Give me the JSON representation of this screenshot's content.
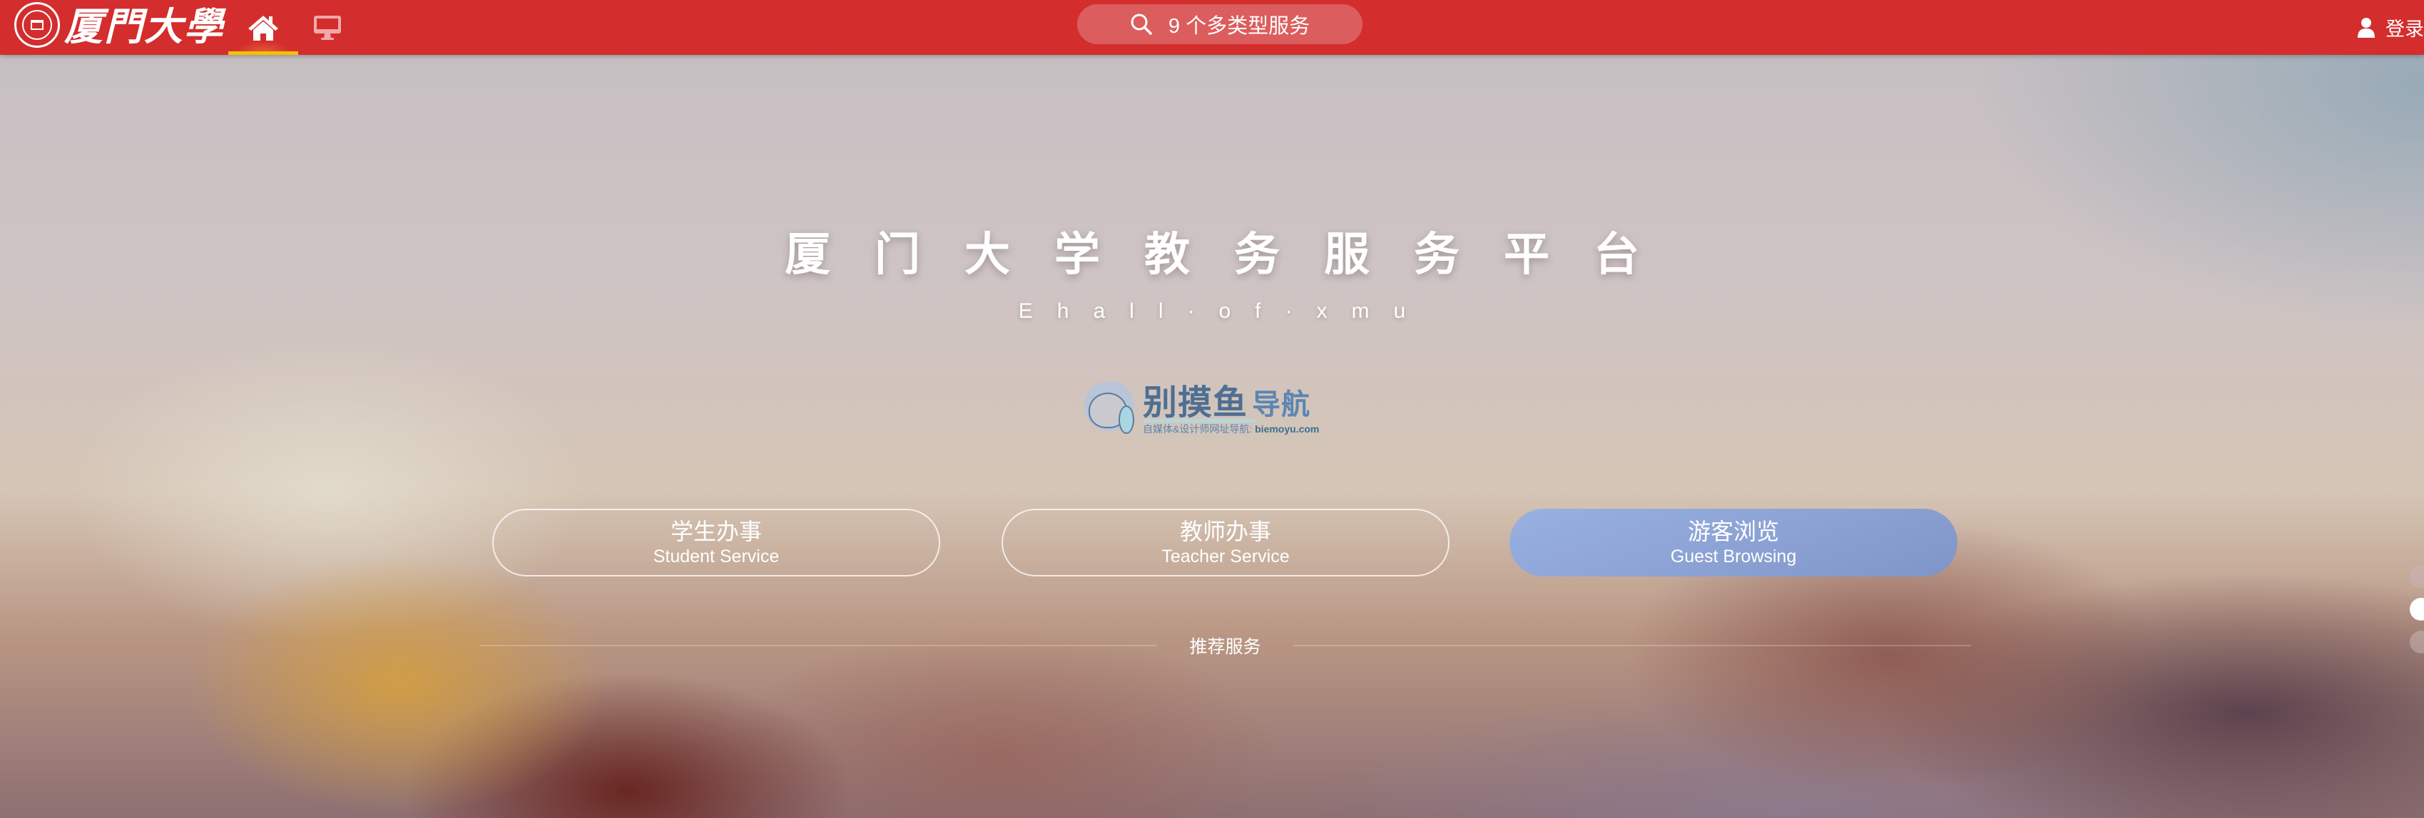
{
  "header": {
    "brand_text": "厦門大學",
    "nav": [
      {
        "name": "home",
        "icon": "home-icon",
        "active": true
      },
      {
        "name": "desktop",
        "icon": "monitor-icon",
        "active": false
      }
    ],
    "search": {
      "icon": "search-icon",
      "placeholder": "9 个多类型服务"
    },
    "login": {
      "icon": "user-icon",
      "label": "登录"
    },
    "colors": {
      "bar": "#d42d2d",
      "active_underline": "#f5c000"
    }
  },
  "hero": {
    "title": "厦门大学教务服务平台",
    "subtitle": "Ehall·of·xmu"
  },
  "watermark": {
    "main": "别摸鱼",
    "accent": "导航",
    "tagline": "自媒体&设计师网址导航:",
    "domain": "biemoyu.com"
  },
  "entry_buttons": [
    {
      "zh": "学生办事",
      "en": "Student Service",
      "style": "outline"
    },
    {
      "zh": "教师办事",
      "en": "Teacher Service",
      "style": "outline"
    },
    {
      "zh": "游客浏览",
      "en": "Guest Browsing",
      "style": "filled",
      "color": "#8fa8d8"
    }
  ],
  "section": {
    "label": "推荐服务"
  },
  "pager": {
    "count": 3,
    "active_index": 1
  }
}
